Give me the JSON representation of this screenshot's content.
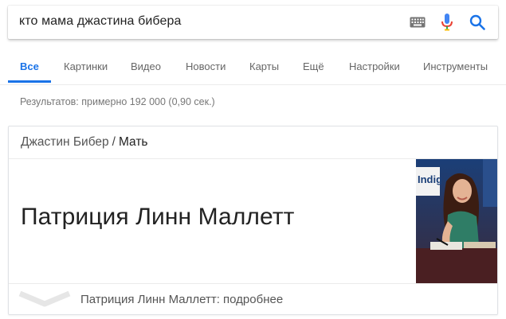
{
  "search": {
    "query": "кто мама джастина бибера",
    "icons": [
      "keyboard-icon",
      "mic-icon",
      "search-icon"
    ],
    "colors": {
      "mic_blue": "#4285f4",
      "mic_red": "#ea4335",
      "search_blue": "#1a73e8"
    }
  },
  "tabs": [
    {
      "label": "Все",
      "active": true
    },
    {
      "label": "Картинки",
      "active": false
    },
    {
      "label": "Видео",
      "active": false
    },
    {
      "label": "Новости",
      "active": false
    },
    {
      "label": "Карты",
      "active": false
    },
    {
      "label": "Ещё",
      "active": false
    },
    {
      "label": "Настройки",
      "active": false
    },
    {
      "label": "Инструменты",
      "active": false
    }
  ],
  "result_stats": "Результатов: примерно 192 000 (0,90 сек.)",
  "knowledge_card": {
    "breadcrumb_entity": "Джастин Бибер",
    "breadcrumb_separator": "/",
    "breadcrumb_attribute": "Мать",
    "answer": "Патриция Линн Маллетт",
    "photo_sign_text": "Indig",
    "footer_text": "Патриция Линн Маллетт: подробнее"
  }
}
